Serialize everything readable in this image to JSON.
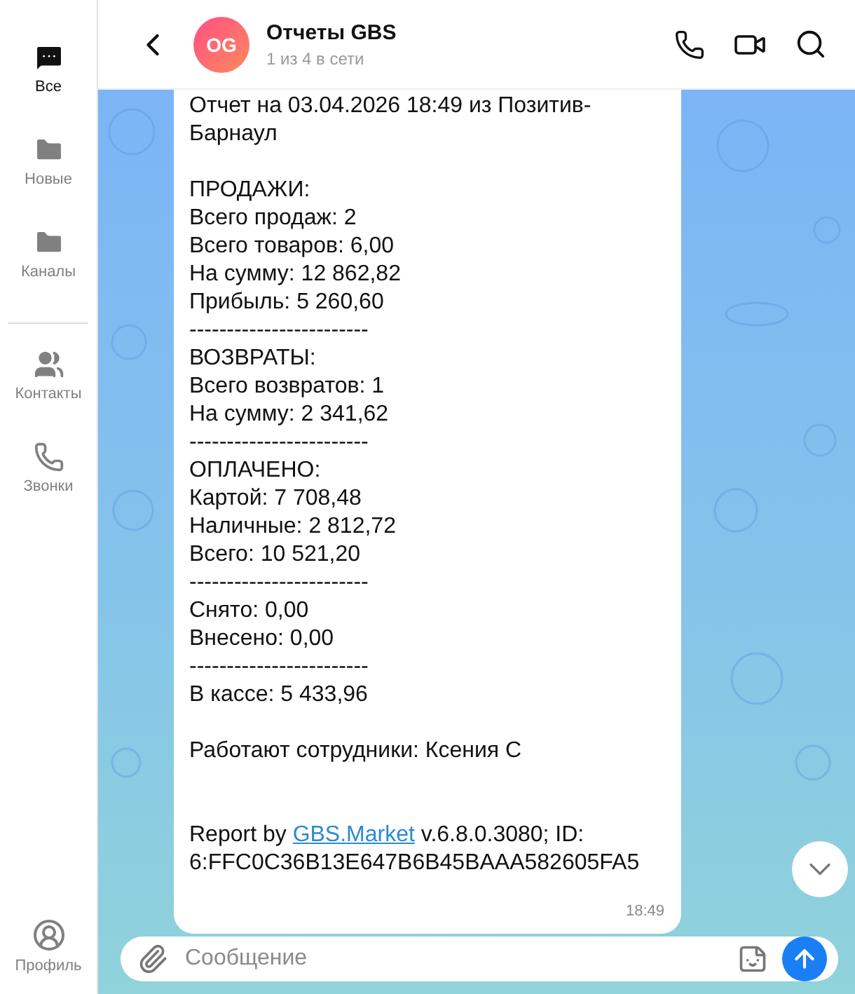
{
  "sidebar": {
    "folders": [
      {
        "label": "Все",
        "selected": true
      },
      {
        "label": "Новые",
        "selected": false
      },
      {
        "label": "Каналы",
        "selected": false
      }
    ],
    "links": [
      {
        "label": "Контакты",
        "kind": "contacts"
      },
      {
        "label": "Звонки",
        "kind": "calls"
      }
    ],
    "profile": {
      "label": "Профиль"
    }
  },
  "header": {
    "avatar": "OG",
    "title": "Отчеты GBS",
    "status": "1 из 4 в сети"
  },
  "message": {
    "paragraphs": [
      [
        "Отчет на 03.04.2026 18:49 из Позитив-Барнаул"
      ],
      [
        "ПРОДАЖИ:",
        "Всего продаж: 2",
        "Всего товаров: 6,00",
        "На сумму: 12 862,82",
        "Прибыль: 5 260,60",
        "------------------------",
        "ВОЗВРАТЫ:",
        "Всего возвратов: 1",
        "На сумму: 2 341,62",
        "------------------------",
        "ОПЛАЧЕНО:",
        "Картой: 7 708,48",
        "Наличные: 2 812,72",
        "Всего: 10 521,20",
        "------------------------",
        "Снято: 0,00",
        "Внесено: 0,00",
        "------------------------",
        "В кассе: 5 433,96"
      ],
      [
        "Работают сотрудники: Ксения С"
      ]
    ],
    "footer": {
      "before": "Report by ",
      "link": "GBS.Market",
      "after": " v.6.8.0.3080; ID: 6:FFC0C36B13E647B6B45BAAA582605FA5"
    },
    "time": "18:49"
  },
  "composer": {
    "placeholder": "Сообщение"
  }
}
